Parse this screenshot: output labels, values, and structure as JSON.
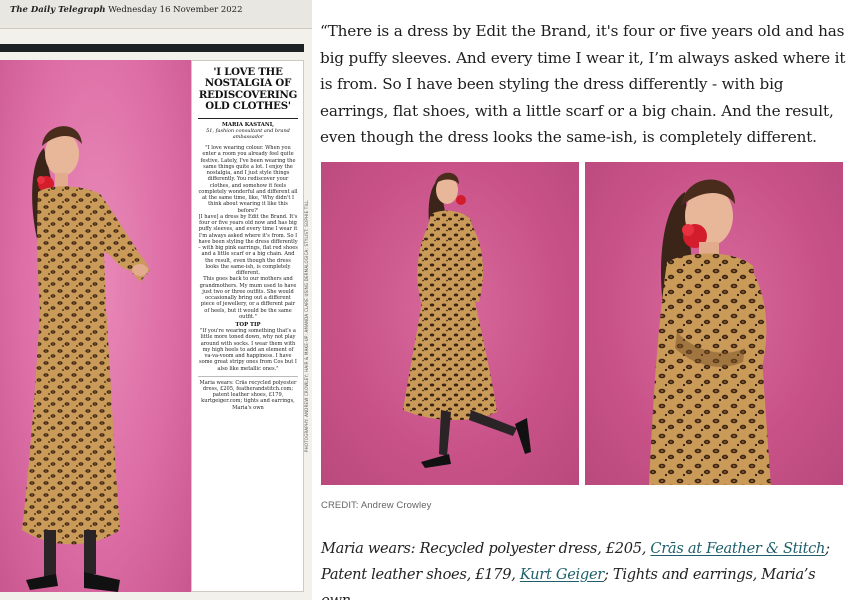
{
  "print": {
    "masthead_paper": "The Daily Telegraph",
    "masthead_date": "Wednesday 16 November 2022",
    "headline": "'I love the nostalgia of rediscovering old clothes'",
    "byline_name": "MARIA KASTANI,",
    "byline_role": "51, fashion consultant and brand ambassador",
    "body": [
      "\"I love wearing colour. When you enter a room you already feel quite festive. Lately, I've been wearing the same things quite a lot. I enjoy the nostalgia, and I just style things differently. You rediscover your clothes, and somehow it feels completely wonderful and different all at the same time, like, 'Why didn't I think about wearing it like this before?'",
      "[I have] a dress by Edit the Brand. It's four or five years old now and has big puffy sleeves, and every time I wear it I'm always asked where it's from. So I have been styling the dress differently – with big pink earrings, flat red shoes and a little scarf or a big chain. And the result, even though the dress looks the same-ish, is completely different.",
      "This goes back to our mothers and grandmothers. My mum used to have just two or three outfits. She would occasionally bring out a different piece of jewellery, or a different pair of heels, but it would be the same outfit.\""
    ],
    "tip_heading": "TOP TIP",
    "tip_body": "\"If you're wearing something that's a little more toned down, why not play around with socks. I wear them with my high heels to add an element of va-va-voom and happiness. I have some great stripy ones from Cos but I also like metallic ones.\"",
    "caption": "Maria wears: Crās recycled polyester dress, £205, featherandstitch.com; patent leather shoes, £179, kurtgeiger.com; tights and earrings, Maria's own",
    "photo_credit_vertical": "PHOTOGRAPHY: ANDREW CROWLEY; HAIR & MAKE-UP: AMANDA CLARE USING DERMALOGICA; STYLIST: SOPHIE TILL"
  },
  "web": {
    "quote": "“There is a dress by Edit the Brand, it's four or five years old and has big puffy sleeves. And every time I wear it, I’m always asked where it is from. So I have been styling the dress differently - with big earrings, flat shoes, with a little scarf or a big chain. And the result, even though the dress looks the same-ish, is completely different.",
    "credit": "CREDIT: Andrew Crowley",
    "wears_prefix": "Maria wears: Recycled polyester dress, £205, ",
    "wears_link1": "Crās at Feather & Stitch",
    "wears_mid": "; Patent leather shoes, £179, ",
    "wears_link2": "Kurt Geiger",
    "wears_suffix": "; Tights and earrings, Maria’s own"
  },
  "colors": {
    "backdrop_pink": "#dd6ea6",
    "leopard_base": "#c79a5a",
    "link_teal": "#1f5f6b",
    "rule_black": "#1f2225"
  }
}
